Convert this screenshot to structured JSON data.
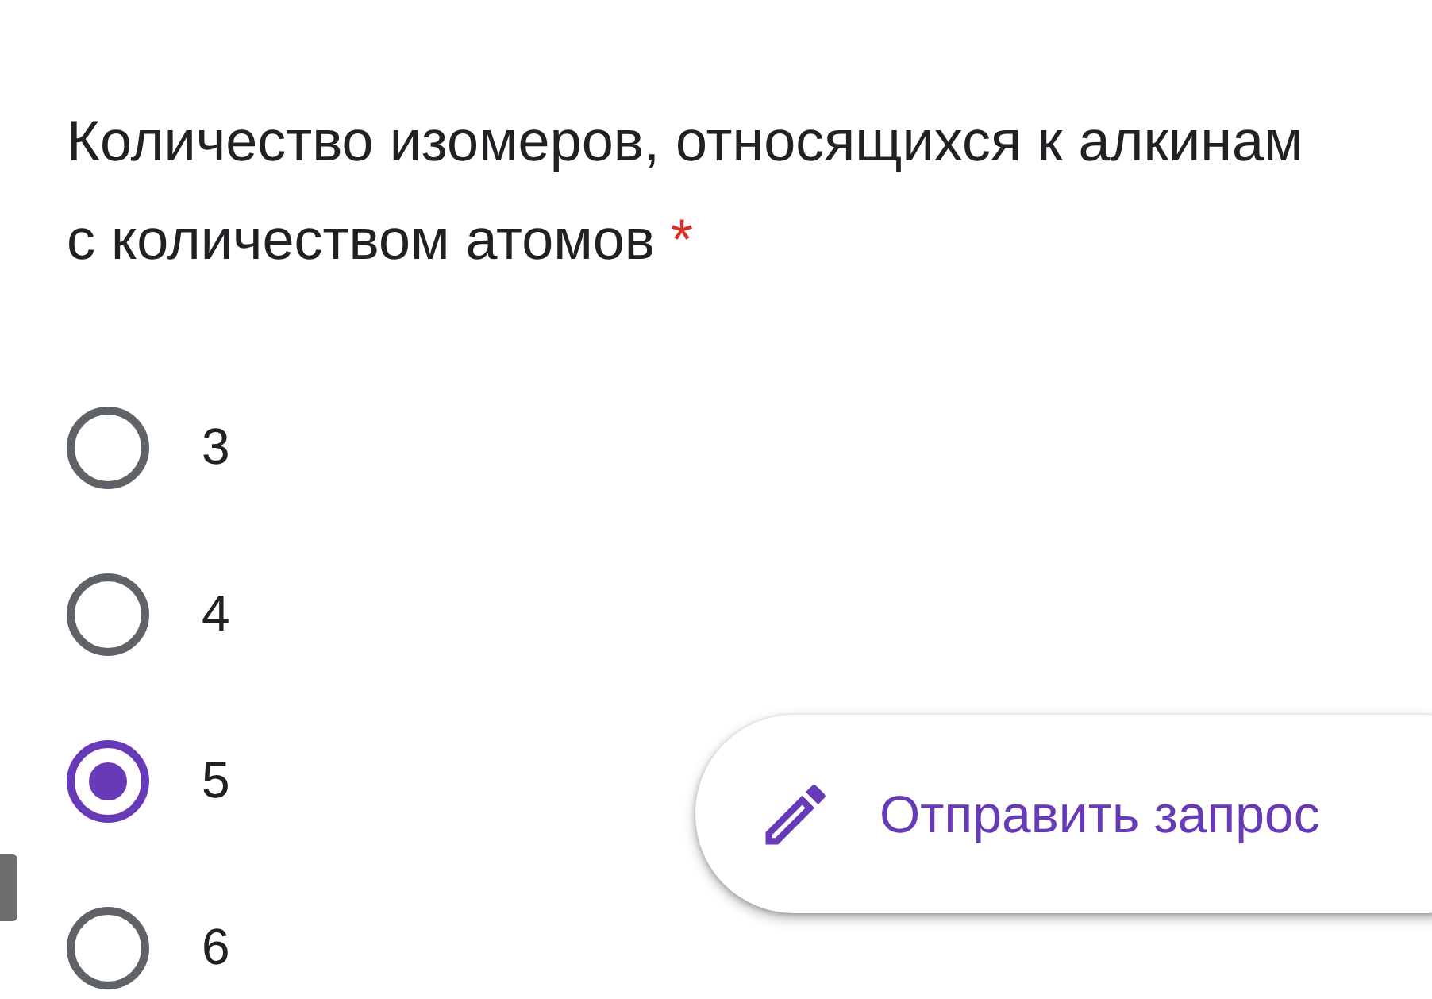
{
  "question": {
    "text": "Количество изомеров, относящихся к алкинам с количеством атомов",
    "required_mark": "*"
  },
  "options": [
    {
      "label": "3",
      "selected": false
    },
    {
      "label": "4",
      "selected": false
    },
    {
      "label": "5",
      "selected": true
    },
    {
      "label": "6",
      "selected": false
    }
  ],
  "fab": {
    "label": "Отправить запрос"
  }
}
